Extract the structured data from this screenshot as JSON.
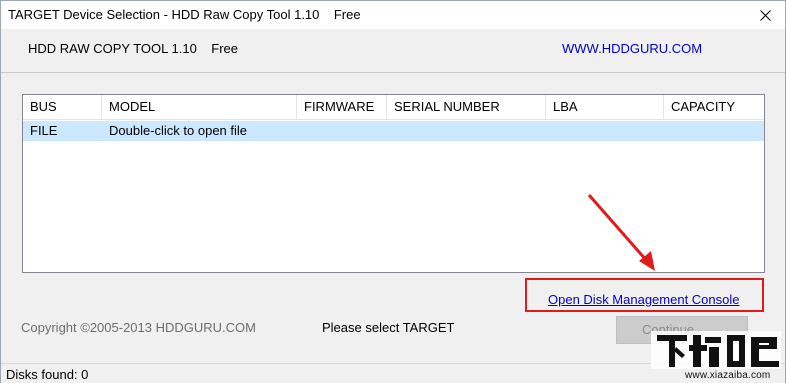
{
  "window": {
    "title": "TARGET Device Selection - HDD Raw Copy Tool 1.10    Free"
  },
  "header": {
    "app_name": "HDD RAW COPY TOOL 1.10    Free",
    "site_link": "WWW.HDDGURU.COM"
  },
  "device_list": {
    "columns": [
      "BUS",
      "MODEL",
      "FIRMWARE",
      "SERIAL NUMBER",
      "LBA",
      "CAPACITY"
    ],
    "rows": [
      {
        "bus": "FILE",
        "model": "Double-click to open file",
        "firmware": "",
        "serial": "",
        "lba": "",
        "capacity": ""
      }
    ]
  },
  "disk_management_link": "Open Disk Management Console",
  "footer": {
    "copyright": "Copyright ©2005-2013 HDDGURU.COM",
    "status": "Please select TARGET",
    "continue_button": "Continue"
  },
  "statusbar": {
    "disks_found": "Disks found: 0"
  },
  "watermark": {
    "url": "www.xiazaiba.com"
  },
  "colors": {
    "selected_row": "#cce8ff",
    "link": "#0000cc",
    "highlight_box": "#e11a1a"
  }
}
